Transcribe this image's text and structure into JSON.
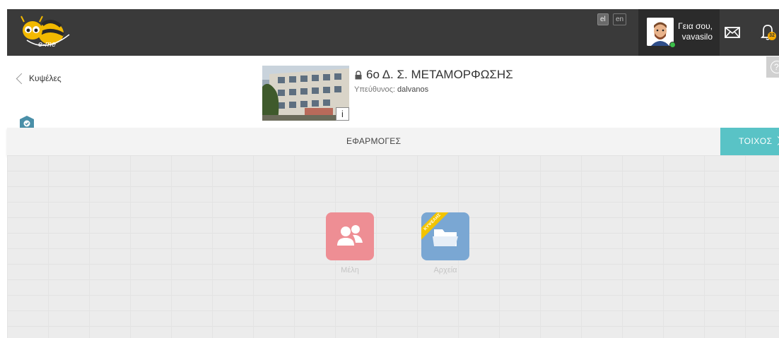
{
  "topbar": {
    "logo_text": "e-me",
    "lang_el": "el",
    "lang_en": "en",
    "greeting_line1": "Γεια σου,",
    "greeting_line2": "vavasilo",
    "notifications_count": "32"
  },
  "header": {
    "back_label": "Κυψέλες",
    "school_title": "6ο Δ. Σ. ΜΕΤΑΜΟΡΦΩΣΗΣ",
    "responsible_label": "Υπεύθυνος:",
    "responsible_name": "dalvanos",
    "info_label": "i",
    "help_label": "?"
  },
  "tabs": {
    "apps_label": "ΕΦΑΡΜΟΓΕΣ",
    "wall_label": "ΤΟΙΧΟΣ"
  },
  "apps": [
    {
      "label": "Μέλη",
      "icon": "members-icon"
    },
    {
      "label": "Αρχεία",
      "icon": "folder-icon",
      "ribbon": "ΚΥΨΕΛΗΣ"
    }
  ],
  "colors": {
    "topbar": "#3a3a3a",
    "accent": "#59c3c6",
    "members_tile": "#ee8e94",
    "files_tile": "#7aa7d3",
    "ribbon": "#f2c400"
  }
}
